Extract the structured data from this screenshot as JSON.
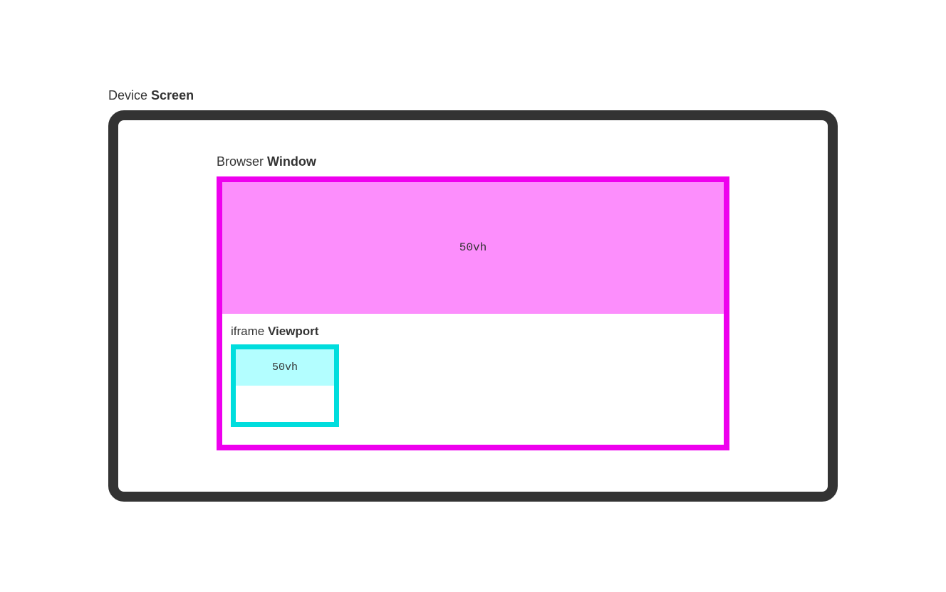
{
  "device": {
    "label_prefix": "Device ",
    "label_bold": "Screen"
  },
  "browser": {
    "label_prefix": "Browser ",
    "label_bold": "Window",
    "fill_label": "50vh",
    "border_color": "#ee00ee",
    "fill_color": "#fc8efc"
  },
  "iframe": {
    "label_prefix": "iframe ",
    "label_bold": "Viewport",
    "fill_label": "50vh",
    "border_color": "#00dddd",
    "fill_color": "#b3feff"
  }
}
